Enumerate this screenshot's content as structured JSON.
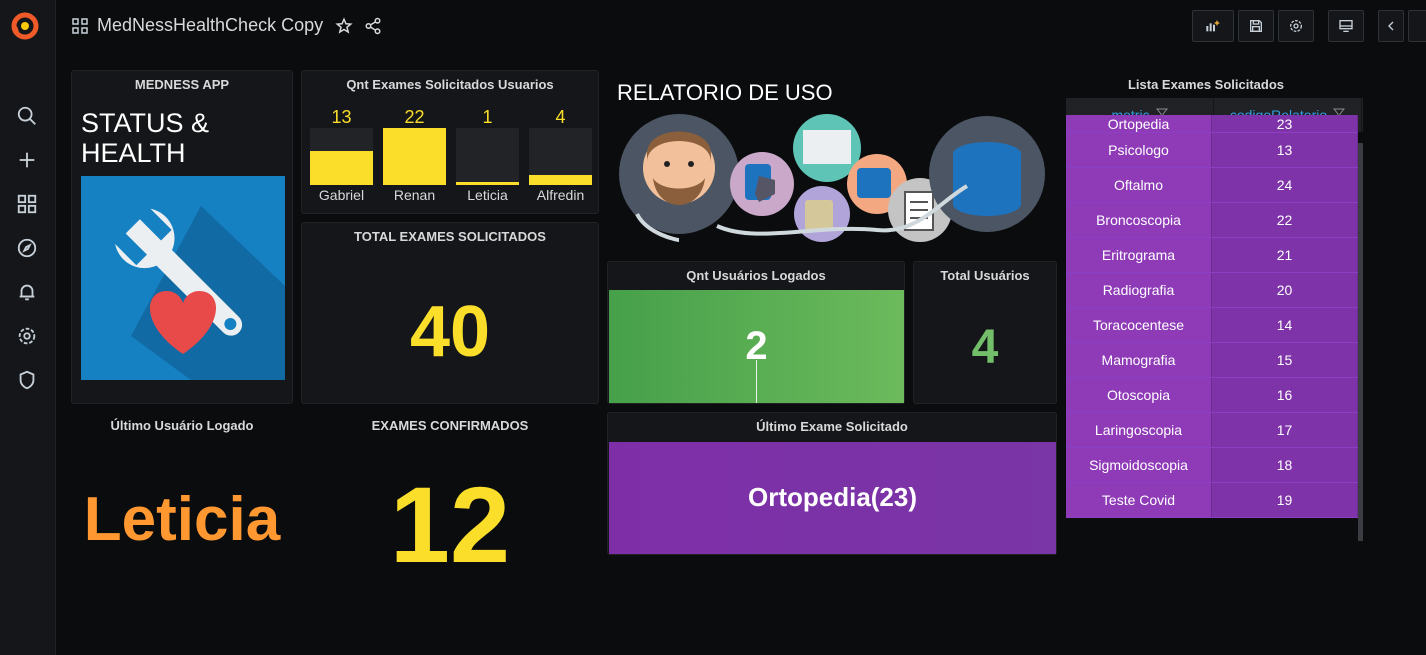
{
  "app": {
    "title": "MedNessHealthCheck Copy"
  },
  "colors": {
    "yellow": "#fade2a",
    "orange": "#ff9830",
    "green": "#73bf69",
    "purple": "#8f3bb8",
    "blue": "#33a2e5"
  },
  "sidebar": {
    "items": [
      "search-icon",
      "plus-icon",
      "dashboards-icon",
      "explore-icon",
      "alerting-icon",
      "configuration-icon",
      "shield-icon"
    ]
  },
  "panels": {
    "medness_app": {
      "title": "MEDNESS APP",
      "text": "STATUS & HEALTH"
    },
    "qnt_exames": {
      "title": "Qnt Exames Solicitados Usuarios",
      "bars": [
        {
          "name": "Gabriel",
          "value": "13",
          "fill": 0.59
        },
        {
          "name": "Renan",
          "value": "22",
          "fill": 1.0
        },
        {
          "name": "Leticia",
          "value": "1",
          "fill": 0.045
        },
        {
          "name": "Alfredin",
          "value": "4",
          "fill": 0.18
        }
      ]
    },
    "total_exames": {
      "title": "TOTAL EXAMES SOLICITADOS",
      "value": "40"
    },
    "relatorio": {
      "title": "RELATORIO DE USO"
    },
    "qnt_usuarios": {
      "title": "Qnt Usuários Logados",
      "value": "2"
    },
    "total_usuarios": {
      "title": "Total Usuários",
      "value": "4"
    },
    "ultimo_usuario": {
      "title": "Último Usuário Logado",
      "value": "Leticia"
    },
    "exames_confirmados": {
      "title": "EXAMES CONFIRMADOS",
      "value": "12"
    },
    "ultimo_exame": {
      "title": "Último Exame Solicitado",
      "value": "Ortopedia(23)"
    },
    "lista_exames": {
      "title": "Lista Exames Solicitados",
      "columns": [
        "metric",
        "codigoRelatorio"
      ],
      "rows": [
        [
          "Ortopedia",
          "23"
        ],
        [
          "Psicologo",
          "13"
        ],
        [
          "Oftalmo",
          "24"
        ],
        [
          "Broncoscopia",
          "22"
        ],
        [
          "Eritrograma",
          "21"
        ],
        [
          "Radiografia",
          "20"
        ],
        [
          "Toracocentese",
          "14"
        ],
        [
          "Mamografia",
          "15"
        ],
        [
          "Otoscopia",
          "16"
        ],
        [
          "Laringoscopia",
          "17"
        ],
        [
          "Sigmoidoscopia",
          "18"
        ],
        [
          "Teste Covid",
          "19"
        ]
      ]
    }
  }
}
